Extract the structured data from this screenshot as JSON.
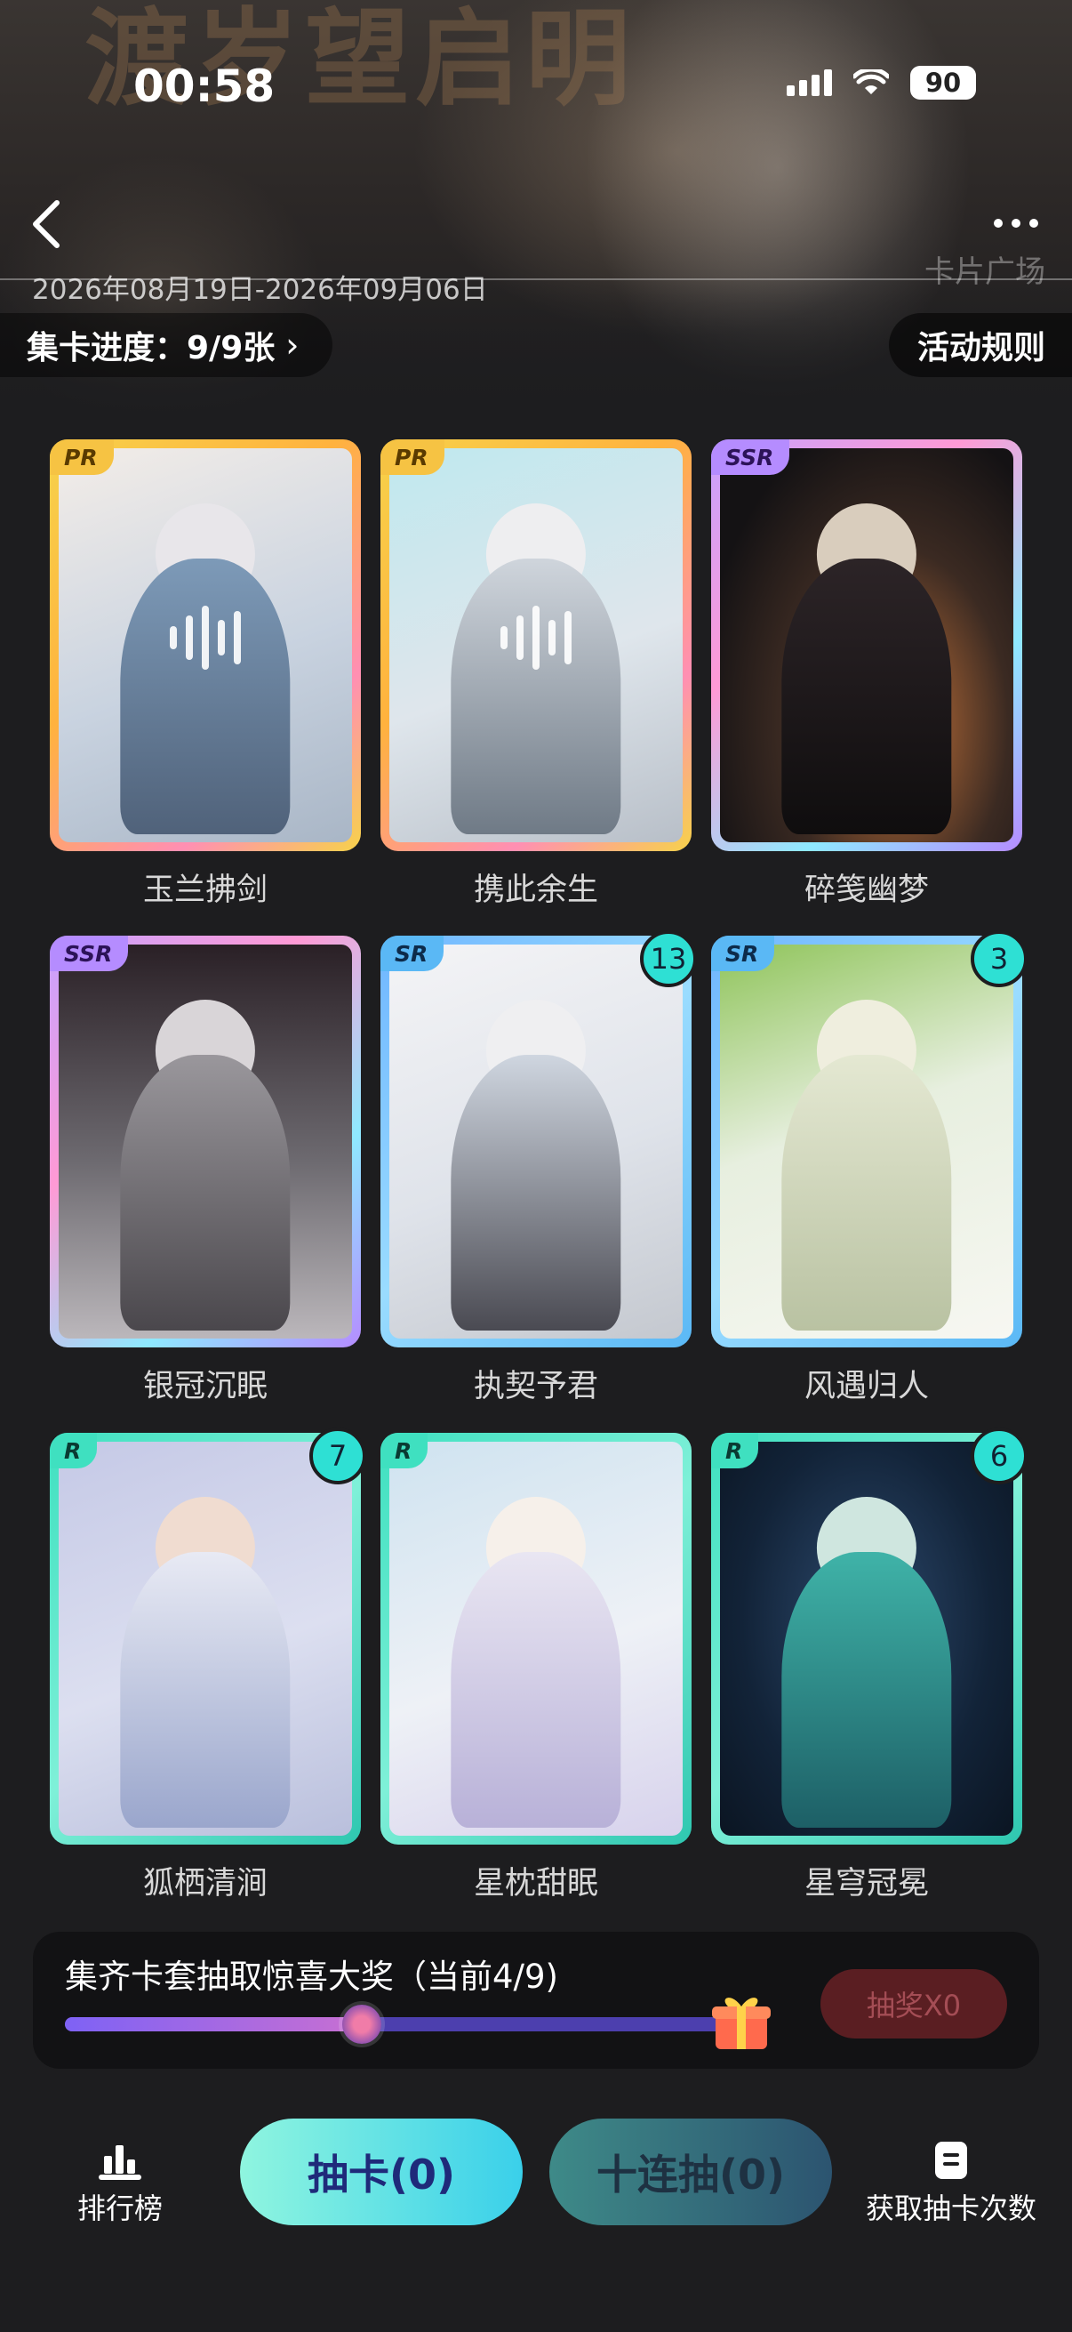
{
  "status_bar": {
    "time": "00:58",
    "battery": "90"
  },
  "header": {
    "hero_title_art": "渡岁望启明",
    "date_range": "2026年08月19日-2026年09月06日",
    "hero_label": "卡片广场",
    "progress_label": "集卡进度：9/9张",
    "rules_label": "活动规则"
  },
  "cards": [
    {
      "name": "玉兰拂剑",
      "rarity": "PR",
      "count": null
    },
    {
      "name": "携此余生",
      "rarity": "PR",
      "count": null
    },
    {
      "name": "碎笺幽梦",
      "rarity": "SSR",
      "count": null
    },
    {
      "name": "银冠沉眠",
      "rarity": "SSR",
      "count": null
    },
    {
      "name": "执契予君",
      "rarity": "SR",
      "count": "13"
    },
    {
      "name": "风遇归人",
      "rarity": "SR",
      "count": "3"
    },
    {
      "name": "狐栖清涧",
      "rarity": "R",
      "count": "7"
    },
    {
      "name": "星枕甜眠",
      "rarity": "R",
      "count": null
    },
    {
      "name": "星穹冠冕",
      "rarity": "R",
      "count": "6"
    }
  ],
  "reward": {
    "title": "集齐卡套抽取惊喜大奖（当前4/9)",
    "progress_fraction": 0.44,
    "lottery_button": "抽奖X0"
  },
  "bottom_bar": {
    "rank_label": "排行榜",
    "draw_label": "抽卡(0)",
    "ten_draw_label": "十连抽(0)",
    "get_more_label": "获取抽卡次数"
  },
  "colors": {
    "PR": "#f6c343",
    "SSR": "#b58cff",
    "SR": "#5ab8f5",
    "R": "#3fe0c0",
    "badge": "#2ee0d4",
    "draw_button": "#3ad0ea"
  },
  "icons": {
    "back": "chevron-left-icon",
    "more": "more-horizontal-icon",
    "gift": "gift-icon",
    "rank": "bar-chart-icon",
    "get_more": "document-icon"
  }
}
